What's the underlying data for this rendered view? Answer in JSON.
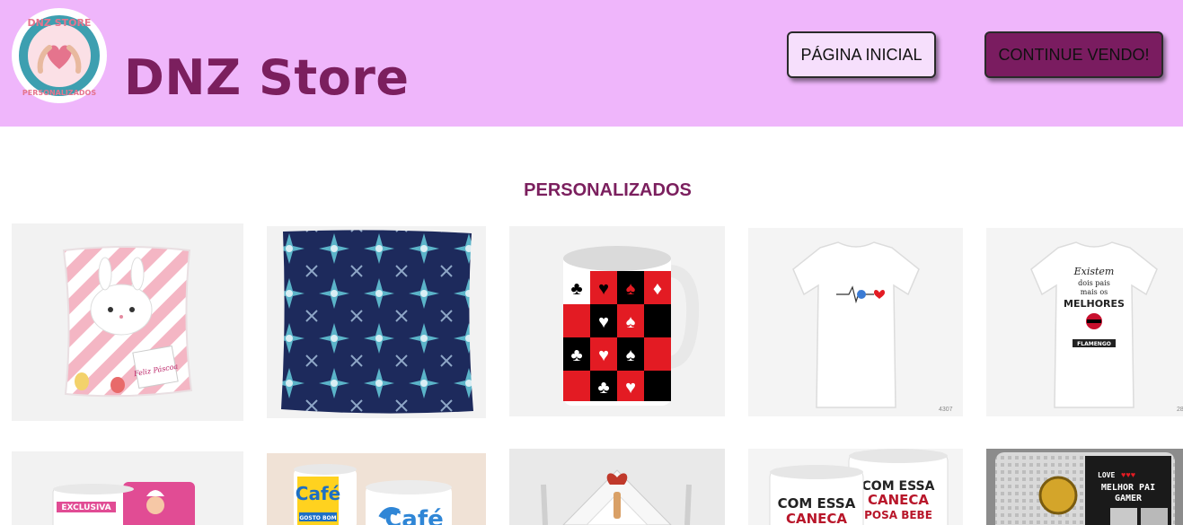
{
  "header": {
    "logo_text_top": "DNZ STORE",
    "logo_text_bottom": "PERSONALIZADOS",
    "brand": "DNZ Store",
    "home_button": "PÁGINA INICIAL",
    "continue_button": "CONTINUE VENDO!"
  },
  "section": {
    "title": "PERSONALIZADOS"
  },
  "products": [
    {
      "name": "bunny-pillow",
      "caption": "Feliz Páscoa"
    },
    {
      "name": "blue-snowflake-pillow"
    },
    {
      "name": "playing-card-mug"
    },
    {
      "name": "heartbeat-tshirt"
    },
    {
      "name": "melhores-tshirt",
      "lines": [
        "Existem",
        "dois pais",
        "mais os",
        "MELHORES",
        "FLAMENGO"
      ]
    },
    {
      "name": "exclusive-mug",
      "caption": "EXCLUSIVA"
    },
    {
      "name": "cafe-mugs",
      "caption": "Café",
      "caption2": "GOSTO BOM"
    },
    {
      "name": "gift-box"
    },
    {
      "name": "com-essa-caneca-mugs",
      "lines": [
        "COM ESSA",
        "CANECA",
        "COM ESSA",
        "CANECA",
        "POSA BEBE"
      ]
    },
    {
      "name": "gamer-pillow",
      "lines": [
        "LOVE",
        "MELHOR PAI",
        "GAMER"
      ]
    }
  ],
  "colors": {
    "header_bg": "#efb6fb",
    "brand": "#7b1f5e",
    "accent_button": "#7a1c60"
  }
}
